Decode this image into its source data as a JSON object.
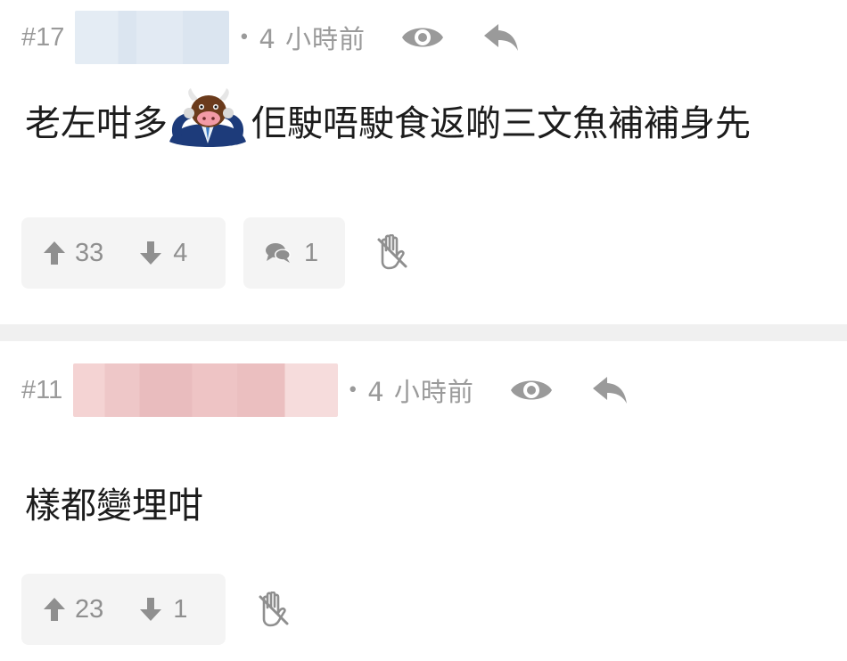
{
  "posts": [
    {
      "number": "#17",
      "dot": "•",
      "time": "4 小時前",
      "content_before": "老左咁多",
      "content_after": "佢駛唔駛食返啲三文魚補補身先",
      "emoji": "cow-in-suit-emoji",
      "upvotes": "33",
      "downvotes": "4",
      "replies": "1",
      "blurred_username_color": "#dbe5f0"
    },
    {
      "number": "#11",
      "dot": "•",
      "time": "4 小時前",
      "content": "樣都變埋咁",
      "upvotes": "23",
      "downvotes": "1",
      "blurred_username_color": "#ecc4c5"
    }
  ],
  "icons": {
    "view": "eye-icon",
    "reply": "reply-arrow-icon",
    "upvote": "arrow-up-icon",
    "downvote": "arrow-down-icon",
    "comment": "comment-bubble-icon",
    "block": "hand-block-icon"
  },
  "colors": {
    "meta_text": "#9a9a9a",
    "content_text": "#1c1c1c",
    "button_bg": "#f4f4f4",
    "separator": "#f0f0f0"
  }
}
